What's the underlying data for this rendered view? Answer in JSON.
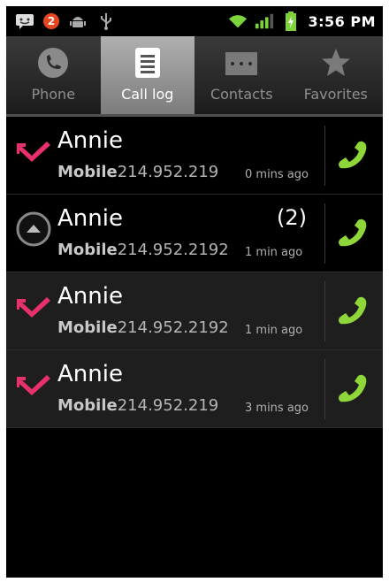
{
  "status_bar": {
    "notification_count": "2",
    "time": "3:56 PM"
  },
  "tabs": [
    {
      "label": "Phone",
      "icon": "phone-icon",
      "active": false
    },
    {
      "label": "Call log",
      "icon": "call-log-icon",
      "active": true
    },
    {
      "label": "Contacts",
      "icon": "contacts-icon",
      "active": false
    },
    {
      "label": "Favorites",
      "icon": "star-icon",
      "active": false
    }
  ],
  "calls": [
    {
      "type": "missed",
      "name": "Annie",
      "count": "",
      "number_label": "Mobile",
      "number": "214.952.219",
      "ago": "0 mins ago"
    },
    {
      "type": "outgoing",
      "name": "Annie",
      "count": "(2)",
      "number_label": "Mobile",
      "number": "214.952.2192",
      "ago": "1 min ago"
    },
    {
      "type": "missed",
      "name": "Annie",
      "count": "",
      "number_label": "Mobile",
      "number": "214.952.2192",
      "ago": "1 min ago"
    },
    {
      "type": "missed",
      "name": "Annie",
      "count": "",
      "number_label": "Mobile",
      "number": "214.952.219",
      "ago": "3 mins ago"
    }
  ],
  "colors": {
    "missed_call": "#e8306a",
    "call_button": "#8fd63a",
    "badge": "#e8461f"
  }
}
